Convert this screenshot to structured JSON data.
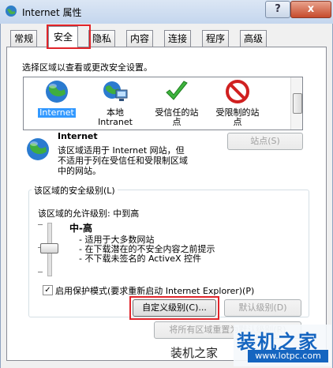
{
  "window": {
    "title": "Internet 属性",
    "help_label": "?",
    "close_label": "x"
  },
  "tabs": [
    "常规",
    "安全",
    "隐私",
    "内容",
    "连接",
    "程序",
    "高级"
  ],
  "security": {
    "zone_prompt": "选择区域以查看或更改安全设置。",
    "zones": [
      {
        "label": "Internet"
      },
      {
        "label": "本地\nIntranet"
      },
      {
        "label": "受信任的站\n点"
      },
      {
        "label": "受限制的站\n点"
      }
    ],
    "zone_title": "Internet",
    "zone_desc": "该区域适用于 Internet 网站，但\n不适用于列在受信任和受限制区域\n中的网站。",
    "sites_button": "站点(S)",
    "level_group": "该区域的安全级别(L)",
    "allowed_levels": "该区域的允许级别: 中到高",
    "level_name": "中-高",
    "level_bullets": [
      "- 适用于大多数网站",
      "- 在下载潜在的不安全内容之前提示",
      "- 不下载未签名的 ActiveX 控件"
    ],
    "protected_mode": "启用保护模式(要求重新启动 Internet Explorer)(P)",
    "protected_checked": "✓",
    "custom_level_button": "自定义级别(C)...",
    "default_level_button": "默认级别(D)",
    "reset_all_button": "将所有区域重置为默认级别(R)"
  },
  "watermark": {
    "text": "装机之家",
    "brand": "装机之家",
    "url": "www.lotpc.com"
  }
}
